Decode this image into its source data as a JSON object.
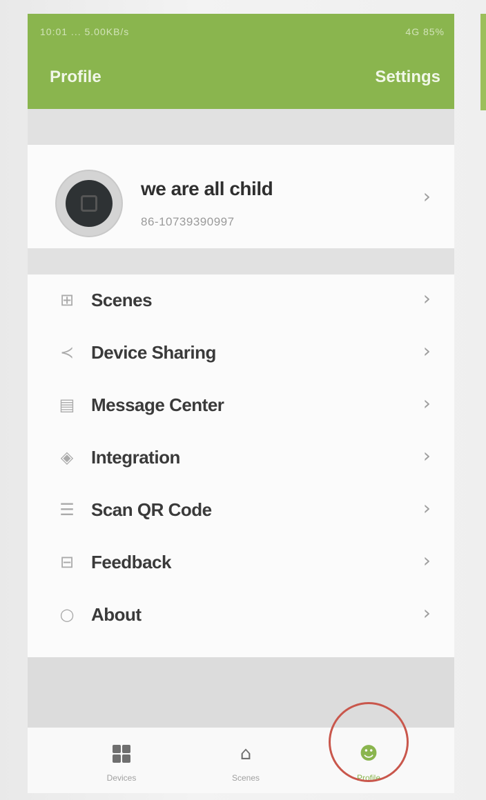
{
  "status_bar": {
    "left": "10:01 ... 5.00KB/s",
    "right": "4G 85%"
  },
  "header": {
    "title": "Profile",
    "action": "Settings"
  },
  "profile": {
    "name": "we are all child",
    "id": "86-10739390997"
  },
  "menu": {
    "items": [
      {
        "label": "Scenes",
        "icon": "scenes-icon",
        "glyph": "⊞"
      },
      {
        "label": "Device Sharing",
        "icon": "share-icon",
        "glyph": "≺"
      },
      {
        "label": "Message Center",
        "icon": "message-icon",
        "glyph": "▤"
      },
      {
        "label": "Integration",
        "icon": "integration-icon",
        "glyph": "◈"
      },
      {
        "label": "Scan QR Code",
        "icon": "qr-scan-icon",
        "glyph": "☰"
      },
      {
        "label": "Feedback",
        "icon": "feedback-icon",
        "glyph": "⊟"
      },
      {
        "label": "About",
        "icon": "info-icon",
        "glyph": "○"
      }
    ],
    "chevron": "›"
  },
  "tabbar": {
    "tabs": [
      {
        "label": "Devices",
        "icon": "devices-grid-icon"
      },
      {
        "label": "Scenes",
        "icon": "home-icon"
      },
      {
        "label": "Profile",
        "icon": "profile-icon",
        "active": true
      }
    ]
  },
  "colors": {
    "accent": "#8ab54e",
    "annotation": "#c9574c"
  }
}
